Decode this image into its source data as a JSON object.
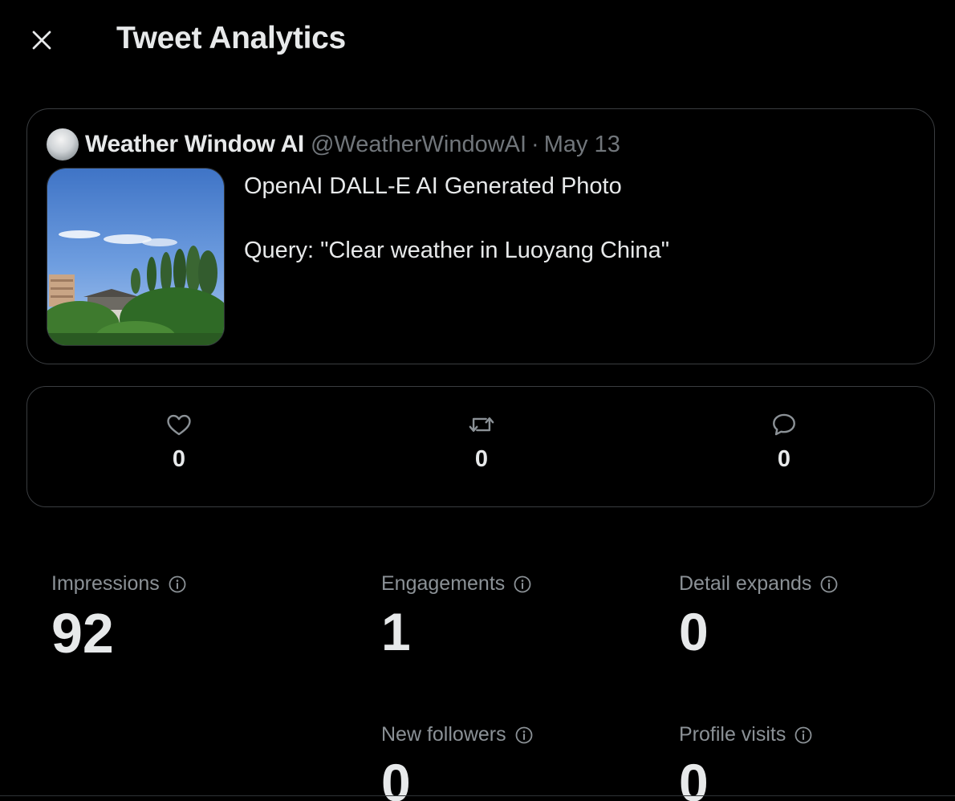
{
  "header": {
    "title": "Tweet Analytics",
    "close_icon": "close-icon"
  },
  "tweet": {
    "author_name": "Weather Window AI",
    "handle": "@WeatherWindowAI",
    "separator": "·",
    "date": "May 13",
    "text": "OpenAI DALL-E AI Generated Photo\n\nQuery: \"Clear weather in Luoyang China\""
  },
  "engagement_row": [
    {
      "icon": "heart-icon",
      "value": "0"
    },
    {
      "icon": "retweet-icon",
      "value": "0"
    },
    {
      "icon": "reply-icon",
      "value": "0"
    }
  ],
  "metrics": {
    "impressions": {
      "label": "Impressions",
      "value": "92"
    },
    "engagements": {
      "label": "Engagements",
      "value": "1"
    },
    "detail_expands": {
      "label": "Detail expands",
      "value": "0"
    },
    "new_followers": {
      "label": "New followers",
      "value": "0"
    },
    "profile_visits": {
      "label": "Profile visits",
      "value": "0"
    }
  },
  "colors": {
    "background": "#000000",
    "text": "#e7e9ea",
    "muted": "#71767b",
    "border": "#3a3d40"
  }
}
